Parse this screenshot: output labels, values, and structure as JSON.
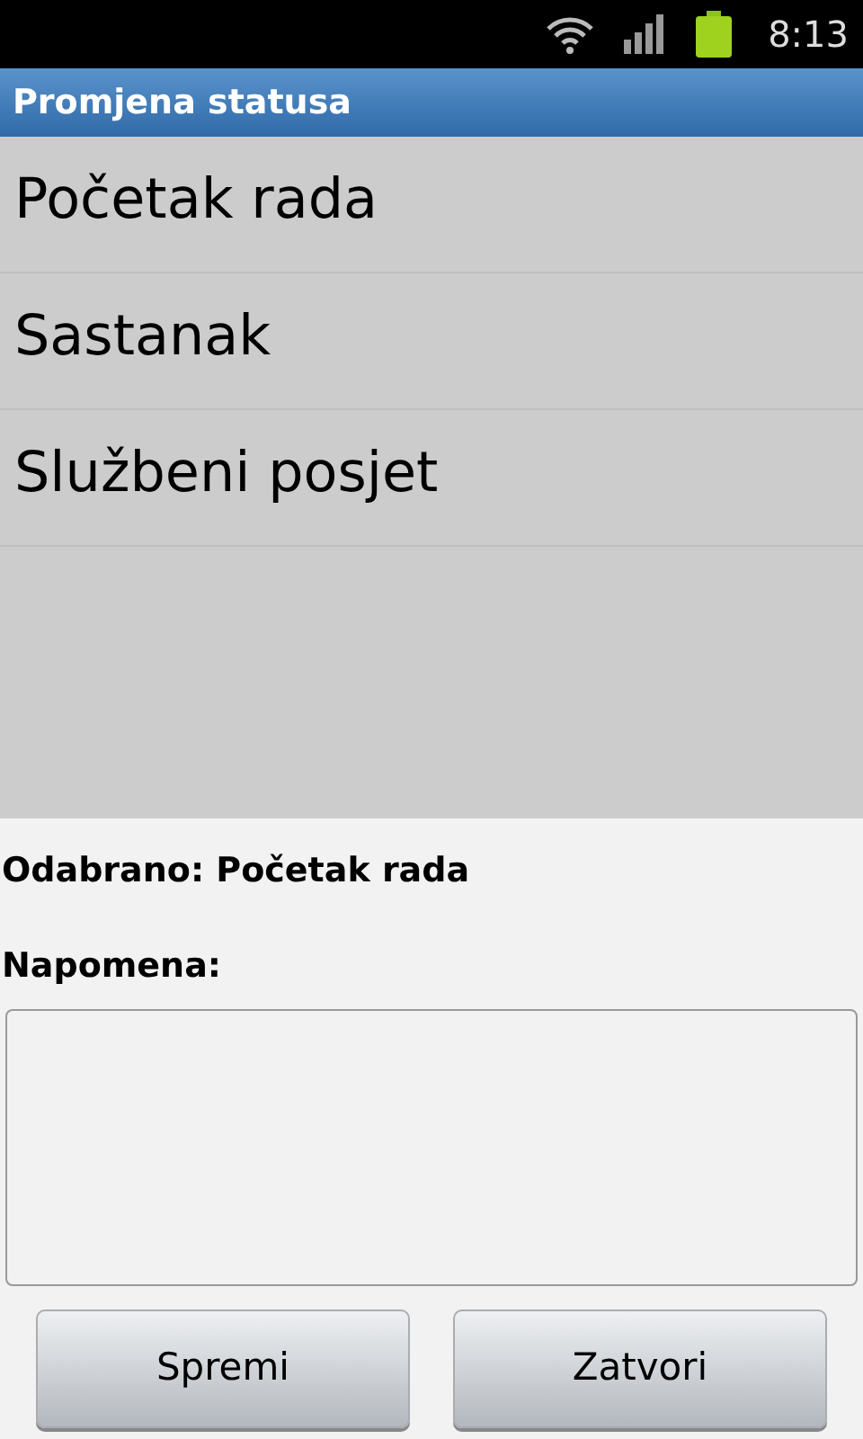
{
  "status_bar": {
    "time": "8:13"
  },
  "window": {
    "title": "Promjena statusa"
  },
  "list": {
    "items": [
      {
        "label": "Početak rada"
      },
      {
        "label": "Sastanak"
      },
      {
        "label": "Službeni posjet"
      }
    ]
  },
  "selection_text": "Odabrano: Početak rada",
  "note": {
    "label": "Napomena:"
  },
  "buttons": [
    {
      "label": "Spremi"
    },
    {
      "label": "Zatvori"
    }
  ]
}
